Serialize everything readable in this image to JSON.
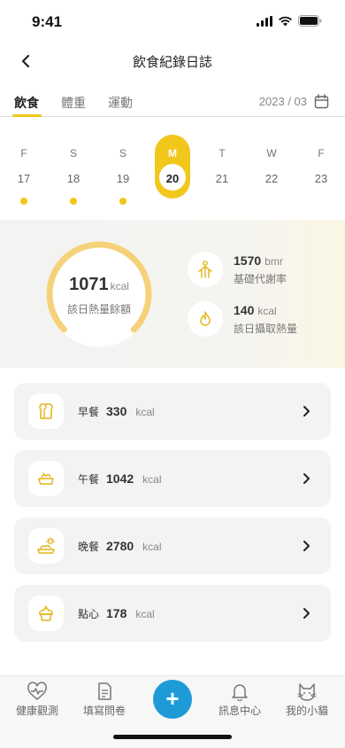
{
  "status_bar": {
    "time": "9:41"
  },
  "nav": {
    "title": "飲食紀錄日誌"
  },
  "tabs": [
    {
      "label": "飲食",
      "active": true
    },
    {
      "label": "體重",
      "active": false
    },
    {
      "label": "運動",
      "active": false
    }
  ],
  "date_picker": {
    "label": "2023 / 03"
  },
  "week": [
    {
      "name": "F",
      "num": "17",
      "has_record": true,
      "selected": false
    },
    {
      "name": "S",
      "num": "18",
      "has_record": true,
      "selected": false
    },
    {
      "name": "S",
      "num": "19",
      "has_record": true,
      "selected": false
    },
    {
      "name": "M",
      "num": "20",
      "has_record": false,
      "selected": true
    },
    {
      "name": "T",
      "num": "21",
      "has_record": false,
      "selected": false
    },
    {
      "name": "W",
      "num": "22",
      "has_record": false,
      "selected": false
    },
    {
      "name": "F",
      "num": "23",
      "has_record": false,
      "selected": false
    }
  ],
  "summary": {
    "remaining_value": "1071",
    "remaining_unit": "kcal",
    "remaining_label": "該日熱量餘額",
    "ring_progress": 0.75,
    "bmr_value": "1570",
    "bmr_unit": "bmr",
    "bmr_label": "基礎代謝率",
    "intake_value": "140",
    "intake_unit": "kcal",
    "intake_label": "該日攝取熱量"
  },
  "meals": [
    {
      "name": "早餐",
      "kcal": "330",
      "unit": "kcal",
      "icon": "bread-icon"
    },
    {
      "name": "午餐",
      "kcal": "1042",
      "unit": "kcal",
      "icon": "lunchbox-icon"
    },
    {
      "name": "晚餐",
      "kcal": "2780",
      "unit": "kcal",
      "icon": "dinner-icon"
    },
    {
      "name": "點心",
      "kcal": "178",
      "unit": "kcal",
      "icon": "cupcake-icon"
    }
  ],
  "bottom_nav": {
    "health": "健康觀測",
    "survey": "填寫問卷",
    "add": "+",
    "messages": "訊息中心",
    "cat": "我的小貓"
  },
  "colors": {
    "accent": "#f2c71b",
    "ring": "#f5d27a",
    "fab": "#1e9bd7"
  }
}
